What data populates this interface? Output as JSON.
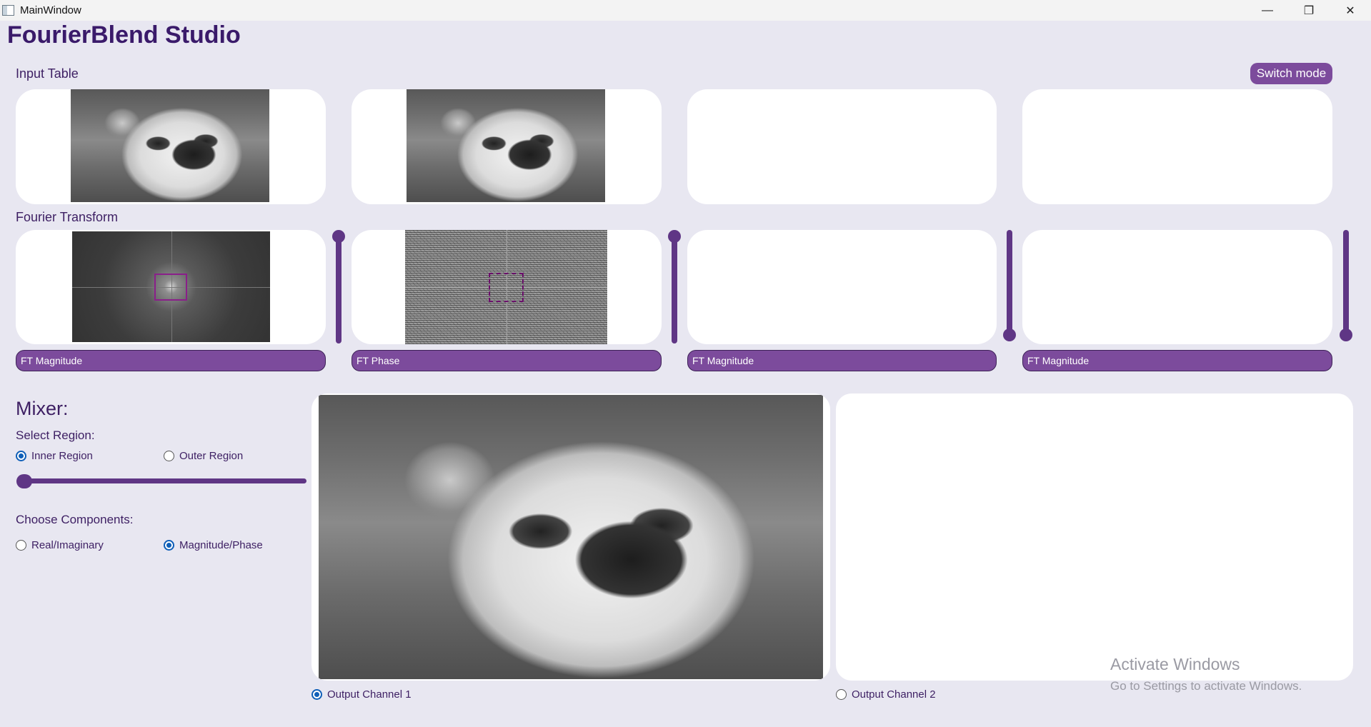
{
  "window": {
    "title": "MainWindow",
    "controls": {
      "minimize": "—",
      "restore": "❐",
      "close": "✕"
    }
  },
  "app": {
    "title": "FourierBlend Studio"
  },
  "input_table": {
    "label": "Input Table",
    "switch_mode_label": "Switch mode",
    "slots": [
      {
        "has_image": true
      },
      {
        "has_image": true
      },
      {
        "has_image": false
      },
      {
        "has_image": false
      }
    ]
  },
  "fourier": {
    "label": "Fourier Transform",
    "components": [
      {
        "label": "FT Magnitude",
        "weight": 1.0
      },
      {
        "label": "FT Phase",
        "weight": 1.0
      },
      {
        "label": "FT Magnitude",
        "weight": 0.0
      },
      {
        "label": "FT Magnitude",
        "weight": 0.0
      }
    ]
  },
  "mixer": {
    "title": "Mixer:",
    "select_region_label": "Select Region:",
    "region_options": [
      {
        "label": "Inner Region",
        "checked": true
      },
      {
        "label": "Outer Region",
        "checked": false
      }
    ],
    "region_size": 0.0,
    "choose_components_label": "Choose Components:",
    "component_options": [
      {
        "label": "Real/Imaginary",
        "checked": false
      },
      {
        "label": "Magnitude/Phase",
        "checked": true
      }
    ]
  },
  "outputs": [
    {
      "label": "Output Channel 1",
      "checked": true
    },
    {
      "label": "Output Channel 2",
      "checked": false
    }
  ],
  "watermark": {
    "line1": "Activate Windows",
    "line2": "Go to Settings to activate Windows."
  },
  "colors": {
    "background": "#e8e7f1",
    "accent": "#7c4b9c",
    "slider": "#5f3685",
    "title_text": "#3a1a6a",
    "radio_checked": "#0f5fb8"
  }
}
